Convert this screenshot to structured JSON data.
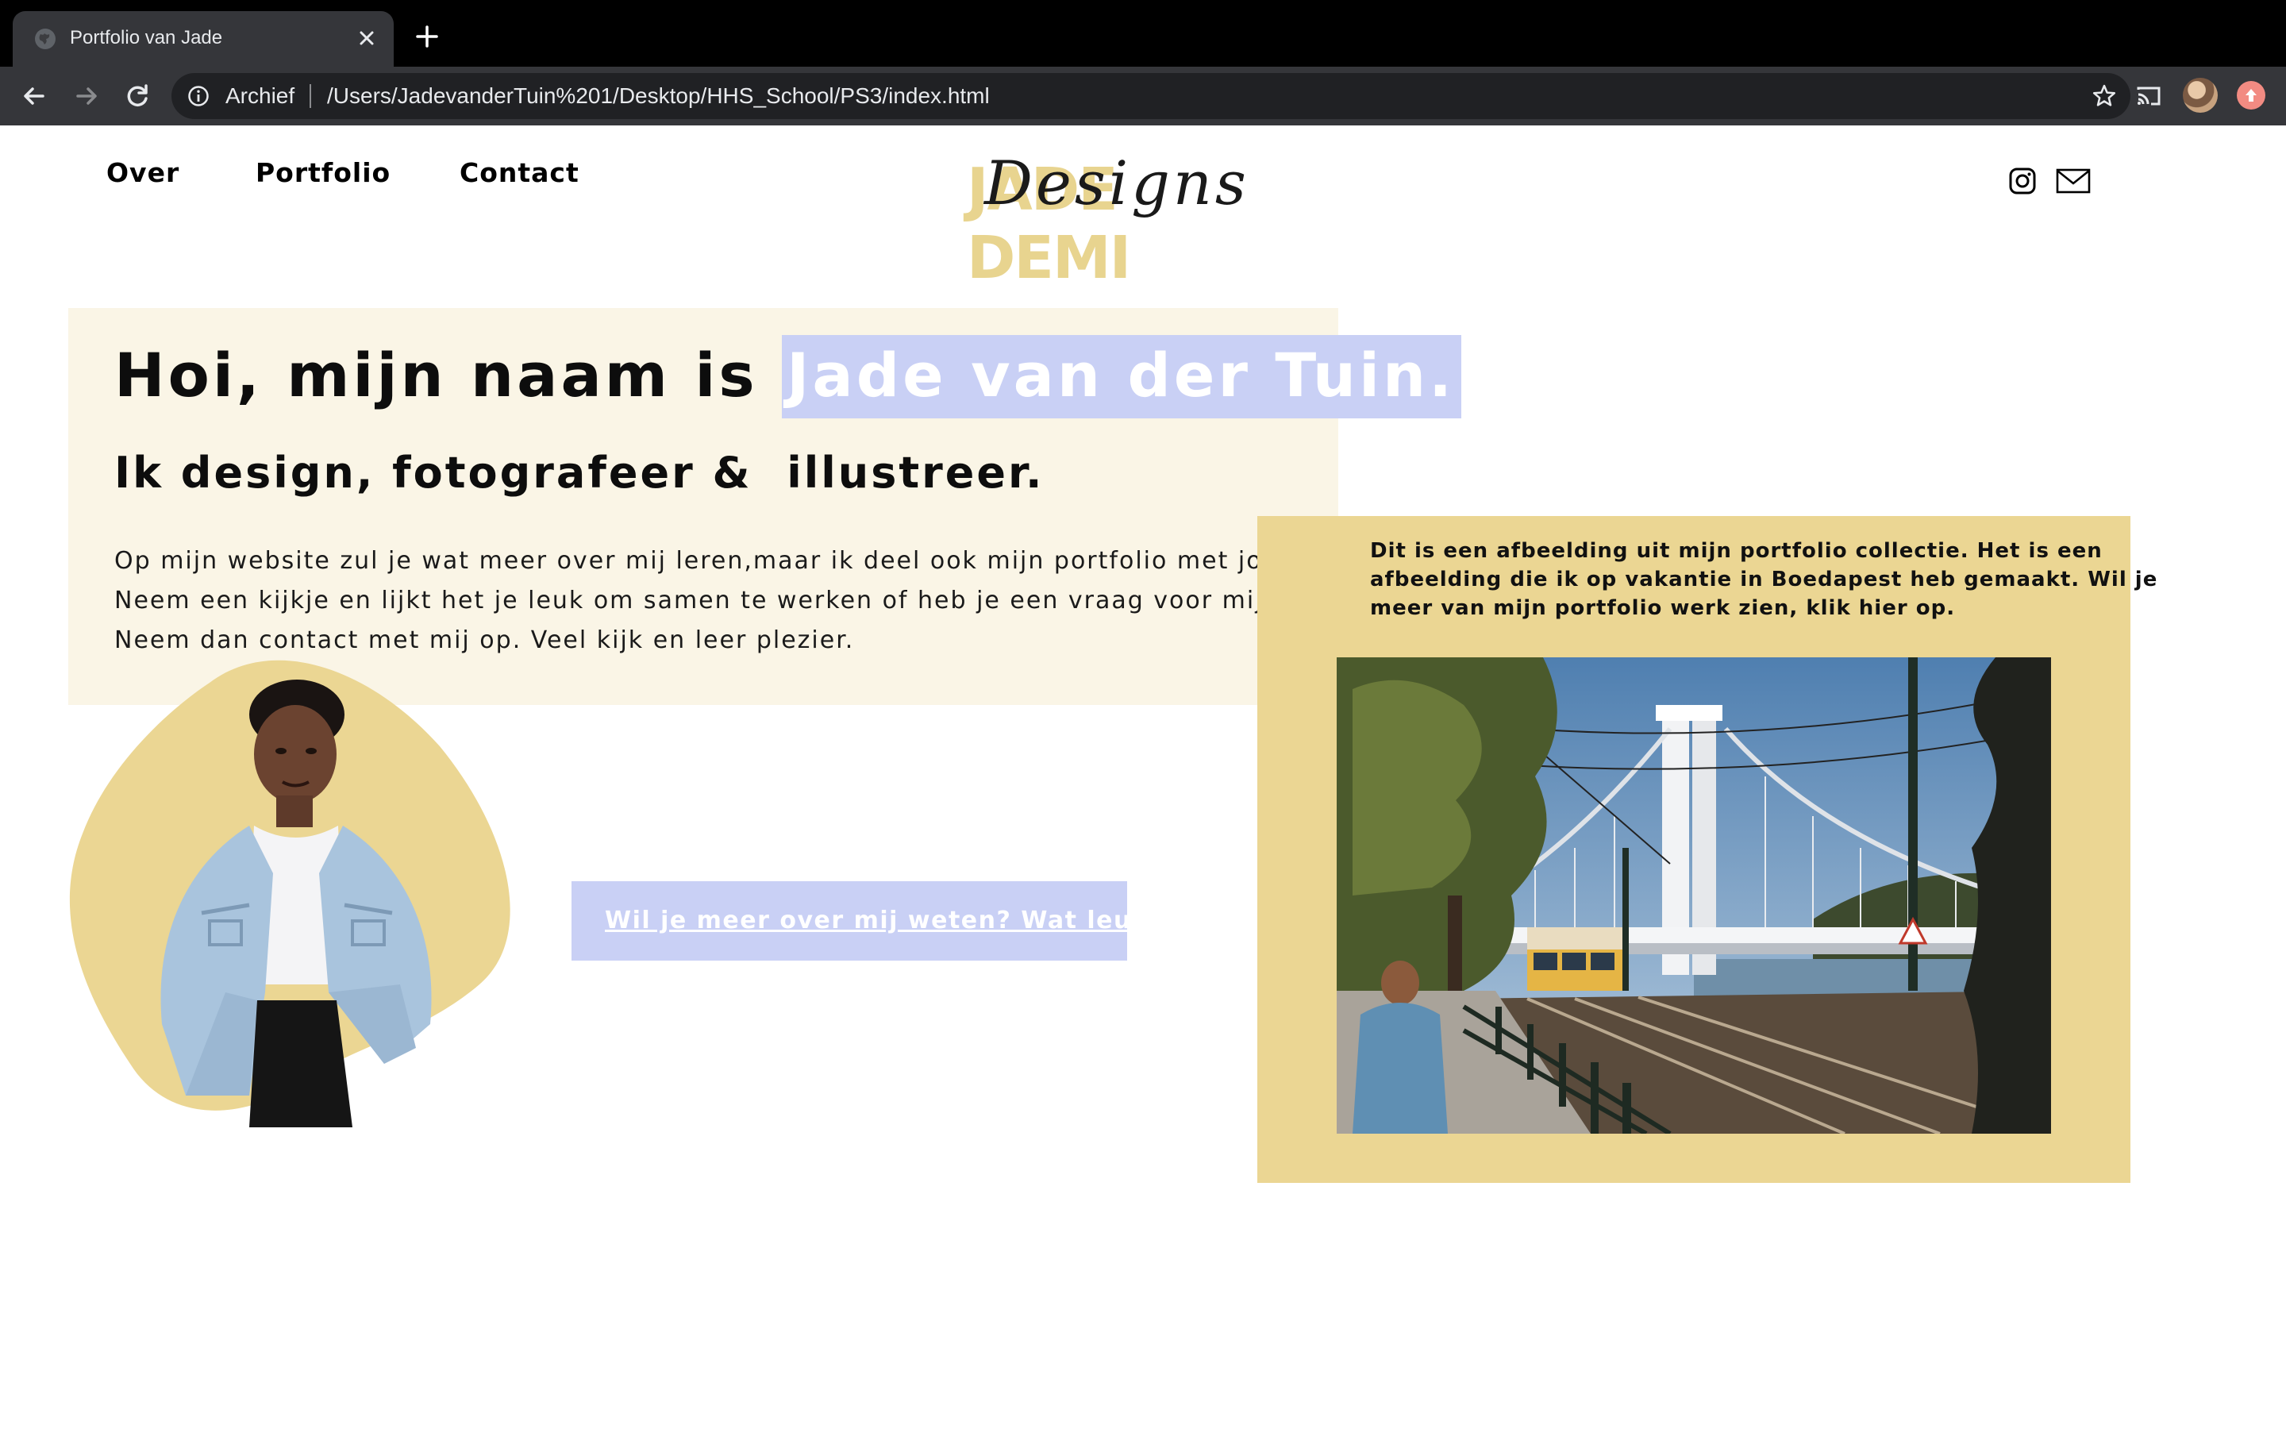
{
  "browser": {
    "tab_title": "Portfolio van Jade",
    "security_label": "Archief",
    "url": "/Users/JadevanderTuin%201/Desktop/HHS_School/PS3/index.html"
  },
  "nav": {
    "items": [
      "Over",
      "Portfolio",
      "Contact"
    ]
  },
  "logo": {
    "wordmark": "JADE DEMI",
    "script": "Designs"
  },
  "hero": {
    "title_prefix": "Hoi, mijn naam is ",
    "title_highlight": "Jade van der Tuin.",
    "subtitle": "Ik design, fotografeer &  illustreer.",
    "body_lines": [
      "Op mijn website zul je wat meer over mij leren,maar ik deel ook mijn portfolio met jou.",
      "Neem een kijkje en lijkt het je leuk om samen te werken of heb je een vraag voor mij?",
      "Neem dan contact met mij op. Veel kijk en leer plezier."
    ]
  },
  "cta": {
    "label": "Wil je meer over mij weten? Wat leuk!"
  },
  "portfolio_card": {
    "text_lines": [
      "Dit is een afbeelding uit mijn portfolio collectie. Het is een",
      "afbeelding die ik op vakantie in Boedapest heb gemaakt. Wil je",
      "meer van mijn portfolio werk zien, klik hier op."
    ]
  },
  "social": {
    "icons": [
      "instagram-icon",
      "mail-icon"
    ]
  },
  "colors": {
    "accent_yellow": "#ebd693",
    "accent_lavender": "#c9d0f5",
    "hero_bg": "#faf5e6",
    "browser_dark": "#35363a"
  }
}
